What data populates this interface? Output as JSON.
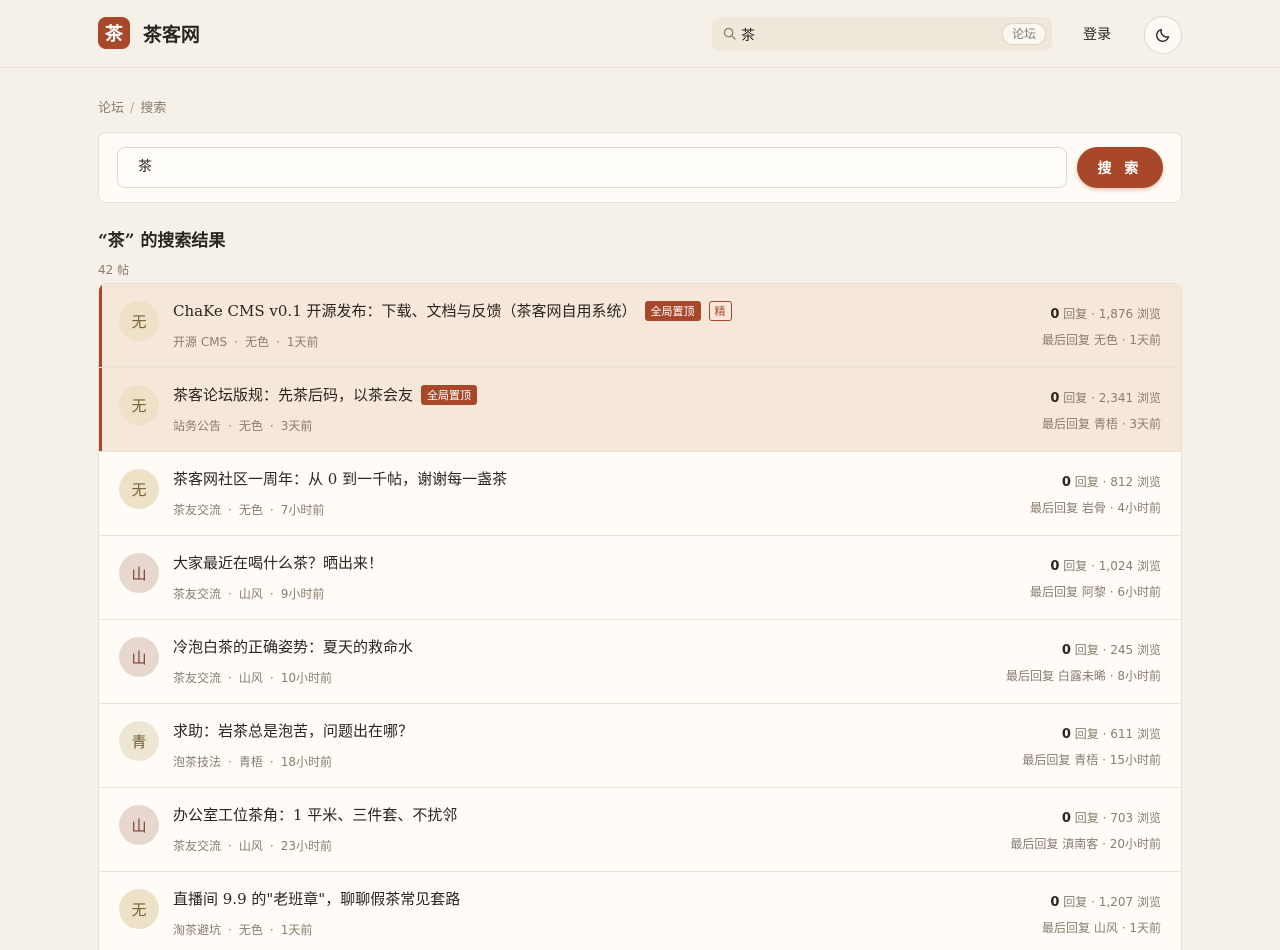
{
  "header": {
    "logo_char": "茶",
    "site_name": "茶客网",
    "search_value": "茶",
    "search_scope": "论坛",
    "login_label": "登录"
  },
  "breadcrumb": {
    "items": [
      "论坛",
      "搜索"
    ],
    "separator": "/"
  },
  "search": {
    "value": "茶",
    "button_label": "搜 索"
  },
  "results": {
    "title": "“茶” 的搜索结果",
    "count": "42 帖",
    "labels": {
      "replies": "回复",
      "views": "浏览",
      "last_reply": "最后回复",
      "dot": "·"
    },
    "items": [
      {
        "avatar": "无",
        "avatar_color": "c0",
        "title": "ChaKe CMS v0.1 开源发布：下载、文档与反馈（茶客网自用系统）",
        "pinned": true,
        "tag_pin": "全局置顶",
        "tag_ess": "精",
        "category": "开源 CMS",
        "author": "无色",
        "time": "1天前",
        "replies": "0",
        "views": "1,876",
        "last_user": "无色",
        "last_time": "1天前"
      },
      {
        "avatar": "无",
        "avatar_color": "c0",
        "title": "茶客论坛版规：先茶后码，以茶会友",
        "pinned": true,
        "tag_pin": "全局置顶",
        "tag_ess": "",
        "category": "站务公告",
        "author": "无色",
        "time": "3天前",
        "replies": "0",
        "views": "2,341",
        "last_user": "青梧",
        "last_time": "3天前"
      },
      {
        "avatar": "无",
        "avatar_color": "c0",
        "title": "茶客网社区一周年：从 0 到一千帖，谢谢每一盏茶",
        "pinned": false,
        "tag_pin": "",
        "tag_ess": "",
        "category": "茶友交流",
        "author": "无色",
        "time": "7小时前",
        "replies": "0",
        "views": "812",
        "last_user": "岩骨",
        "last_time": "4小时前"
      },
      {
        "avatar": "山",
        "avatar_color": "c1",
        "title": "大家最近在喝什么茶？晒出来！",
        "pinned": false,
        "tag_pin": "",
        "tag_ess": "",
        "category": "茶友交流",
        "author": "山风",
        "time": "9小时前",
        "replies": "0",
        "views": "1,024",
        "last_user": "阿黎",
        "last_time": "6小时前"
      },
      {
        "avatar": "山",
        "avatar_color": "c1",
        "title": "冷泡白茶的正确姿势：夏天的救命水",
        "pinned": false,
        "tag_pin": "",
        "tag_ess": "",
        "category": "茶友交流",
        "author": "山风",
        "time": "10小时前",
        "replies": "0",
        "views": "245",
        "last_user": "白露未晞",
        "last_time": "8小时前"
      },
      {
        "avatar": "青",
        "avatar_color": "c2",
        "title": "求助：岩茶总是泡苦，问题出在哪？",
        "pinned": false,
        "tag_pin": "",
        "tag_ess": "",
        "category": "泡茶技法",
        "author": "青梧",
        "time": "18小时前",
        "replies": "0",
        "views": "611",
        "last_user": "青梧",
        "last_time": "15小时前"
      },
      {
        "avatar": "山",
        "avatar_color": "c1",
        "title": "办公室工位茶角：1 平米、三件套、不扰邻",
        "pinned": false,
        "tag_pin": "",
        "tag_ess": "",
        "category": "茶友交流",
        "author": "山风",
        "time": "23小时前",
        "replies": "0",
        "views": "703",
        "last_user": "滇南客",
        "last_time": "20小时前"
      },
      {
        "avatar": "无",
        "avatar_color": "c0",
        "title": "直播间 9.9 的\"老班章\"，聊聊假茶常见套路",
        "pinned": false,
        "tag_pin": "",
        "tag_ess": "",
        "category": "淘茶避坑",
        "author": "无色",
        "time": "1天前",
        "replies": "0",
        "views": "1,207",
        "last_user": "山风",
        "last_time": "1天前"
      }
    ]
  },
  "colors": {
    "accent": "#a9472a",
    "background": "#f6f1e8",
    "card": "#fffcf7",
    "pinned_row": "#f5e7da",
    "muted_text": "#8a7d70"
  },
  "icons": {
    "search": "search-icon",
    "theme": "moon-icon"
  }
}
